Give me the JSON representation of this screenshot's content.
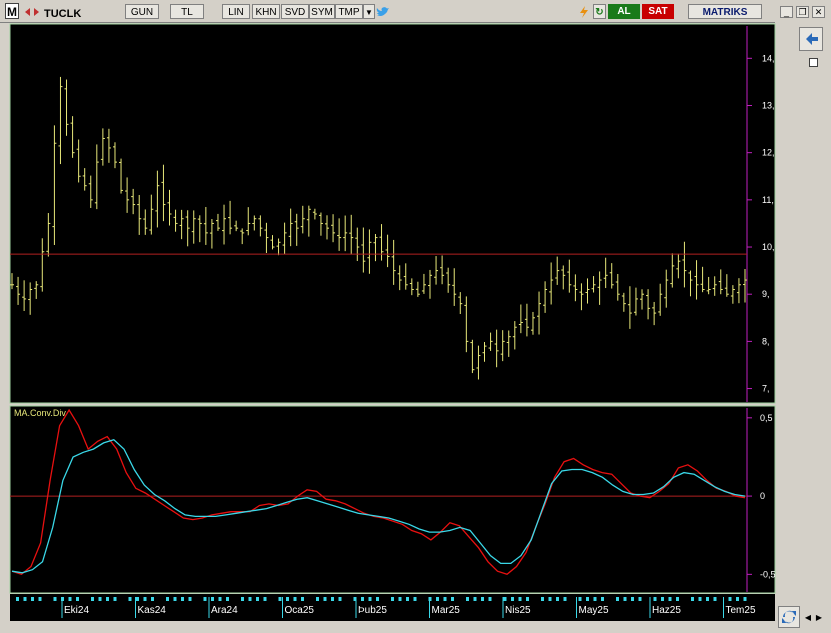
{
  "toolbar": {
    "logo": "M",
    "symbol": "TUCLK",
    "period": "GUN",
    "currency": "TL",
    "scale": "LIN",
    "buttons": [
      "KHN",
      "SVD",
      "SYM",
      "TMP"
    ],
    "buy_label": "AL",
    "sell_label": "SAT",
    "brand": "MATRIKS"
  },
  "price_axis": {
    "ticks": [
      "14,",
      "13,",
      "12,",
      "11,",
      "10,",
      "9,",
      "8,",
      "7,"
    ]
  },
  "indicator": {
    "name": "MA.Conv.Div",
    "ticks": [
      "0,5",
      "0",
      "-0,5"
    ]
  },
  "time_axis": {
    "labels": [
      "Eki24",
      "Kas24",
      "Ara24",
      "Oca25",
      "Þub25",
      "Mar25",
      "Nis25",
      "May25",
      "Haz25",
      "Tem25"
    ]
  },
  "colors": {
    "price_bars": "#e8e87a",
    "signal_line": "#3ad8e8",
    "macd_line": "#e81010",
    "reference_line": "#b22020",
    "background": "#000000",
    "accent": "#2a6ab8"
  },
  "chart_data": [
    {
      "type": "ohlc",
      "ylim": [
        6.8,
        14.6
      ],
      "reference_level": 9.85,
      "bars_approx": [
        {
          "period": "Eki24",
          "low": 8.7,
          "high": 14.1
        },
        {
          "period": "Kas24",
          "low": 10.0,
          "high": 11.8
        },
        {
          "period": "Ara24",
          "low": 10.0,
          "high": 11.2
        },
        {
          "period": "Oca25",
          "low": 9.9,
          "high": 11.2
        },
        {
          "period": "Þub25",
          "low": 9.6,
          "high": 10.5
        },
        {
          "period": "Mar25",
          "low": 7.1,
          "high": 9.6
        },
        {
          "period": "Nis25",
          "low": 7.6,
          "high": 9.0
        },
        {
          "period": "May25",
          "low": 8.8,
          "high": 9.6
        },
        {
          "period": "Haz25",
          "low": 8.3,
          "high": 9.8
        },
        {
          "period": "Tem25",
          "low": 8.9,
          "high": 9.7
        }
      ],
      "close_series": [
        9.2,
        9.0,
        8.9,
        9.1,
        9.2,
        9.9,
        10.5,
        12.2,
        13.4,
        12.6,
        12.0,
        11.5,
        11.3,
        11.0,
        11.8,
        12.3,
        12.1,
        11.8,
        11.2,
        11.0,
        10.9,
        10.6,
        10.4,
        10.8,
        11.3,
        10.9,
        10.7,
        10.5,
        10.6,
        10.4,
        10.6,
        10.5,
        10.3,
        10.5,
        10.4,
        10.6,
        10.4,
        10.4,
        10.3,
        10.5,
        10.6,
        10.4,
        10.2,
        10.0,
        10.1,
        10.3,
        10.5,
        10.4,
        10.6,
        10.8,
        10.7,
        10.5,
        10.4,
        10.3,
        10.2,
        10.3,
        10.2,
        10.0,
        9.7,
        10.1,
        10.2,
        9.9,
        9.8,
        9.5,
        9.3,
        9.2,
        9.1,
        9.0,
        9.2,
        9.4,
        9.5,
        9.4,
        9.2,
        9.0,
        8.8,
        8.0,
        7.4,
        7.7,
        7.9,
        8.0,
        7.8,
        8.0,
        8.1,
        8.3,
        8.4,
        8.3,
        8.5,
        8.8,
        9.1,
        9.3,
        9.5,
        9.4,
        9.2,
        9.1,
        9.0,
        9.1,
        9.2,
        9.3,
        9.4,
        9.2,
        9.0,
        8.8,
        8.6,
        8.9,
        9.0,
        8.7,
        8.6,
        9.0,
        9.3,
        9.6,
        9.7,
        9.5,
        9.3,
        9.2,
        9.1,
        9.1,
        9.2,
        9.1,
        9.0,
        9.1,
        9.2,
        9.3
      ]
    },
    {
      "type": "line",
      "title": "MA.Conv.Div",
      "ylim": [
        -0.6,
        0.55
      ],
      "series": [
        {
          "color": "#e81010",
          "values": [
            -0.48,
            -0.5,
            -0.45,
            -0.3,
            0.1,
            0.45,
            0.55,
            0.45,
            0.3,
            0.35,
            0.38,
            0.3,
            0.15,
            0.05,
            0.02,
            -0.02,
            -0.06,
            -0.1,
            -0.14,
            -0.15,
            -0.14,
            -0.12,
            -0.11,
            -0.1,
            -0.1,
            -0.1,
            -0.06,
            -0.05,
            -0.06,
            -0.05,
            0.0,
            0.04,
            0.03,
            -0.02,
            -0.03,
            -0.05,
            -0.08,
            -0.11,
            -0.13,
            -0.14,
            -0.16,
            -0.18,
            -0.22,
            -0.24,
            -0.28,
            -0.23,
            -0.17,
            -0.19,
            -0.26,
            -0.33,
            -0.42,
            -0.48,
            -0.5,
            -0.45,
            -0.36,
            -0.2,
            -0.05,
            0.12,
            0.22,
            0.24,
            0.2,
            0.17,
            0.15,
            0.14,
            0.08,
            0.02,
            0.0,
            -0.01,
            0.03,
            0.08,
            0.18,
            0.2,
            0.16,
            0.1,
            0.05,
            0.03,
            0.0,
            -0.01
          ]
        },
        {
          "color": "#3ad8e8",
          "values": [
            -0.48,
            -0.49,
            -0.47,
            -0.42,
            -0.2,
            0.1,
            0.25,
            0.28,
            0.3,
            0.34,
            0.36,
            0.3,
            0.17,
            0.07,
            0.01,
            -0.03,
            -0.08,
            -0.12,
            -0.13,
            -0.13,
            -0.13,
            -0.12,
            -0.11,
            -0.1,
            -0.09,
            -0.08,
            -0.06,
            -0.04,
            -0.02,
            -0.01,
            -0.03,
            -0.05,
            -0.07,
            -0.09,
            -0.11,
            -0.12,
            -0.13,
            -0.14,
            -0.16,
            -0.18,
            -0.21,
            -0.23,
            -0.23,
            -0.22,
            -0.2,
            -0.22,
            -0.3,
            -0.38,
            -0.43,
            -0.43,
            -0.38,
            -0.28,
            -0.1,
            0.08,
            0.16,
            0.17,
            0.17,
            0.15,
            0.12,
            0.07,
            0.03,
            0.01,
            0.01,
            0.02,
            0.06,
            0.12,
            0.15,
            0.14,
            0.1,
            0.06,
            0.03,
            0.01,
            0.0
          ]
        }
      ]
    }
  ]
}
